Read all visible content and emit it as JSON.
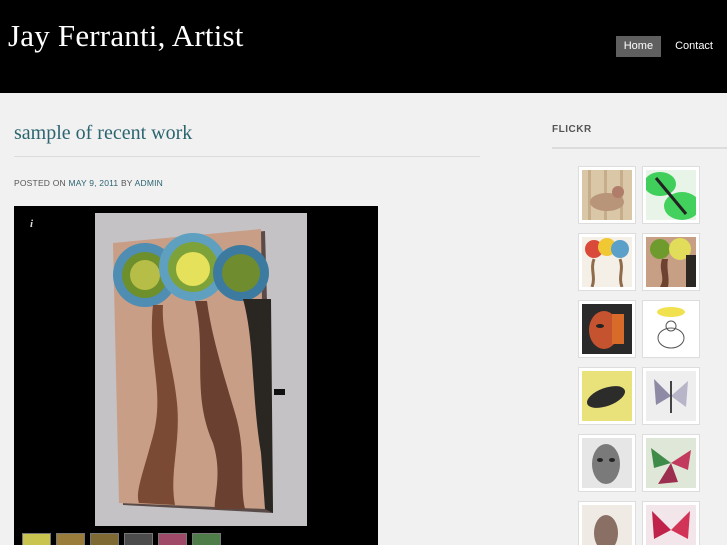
{
  "header": {
    "site_title": "Jay Ferranti, Artist",
    "nav": [
      {
        "label": "Home",
        "active": true
      },
      {
        "label": "Contact",
        "active": false
      }
    ]
  },
  "post": {
    "title": "sample of recent work",
    "meta": {
      "posted_on": "POSTED ON",
      "date": "MAY 9, 2011",
      "by": "BY",
      "author": "ADMIN"
    },
    "gallery": {
      "info_icon": "i",
      "main_image": "painting-of-three-trees-canvas",
      "thumbnails": [
        "thumb-1",
        "thumb-2",
        "thumb-3",
        "thumb-4",
        "thumb-5",
        "thumb-6"
      ]
    }
  },
  "sidebar": {
    "widget_title": "FLICKR",
    "photos": [
      "bird-drawing",
      "green-leaf-branch",
      "tree-lollipops",
      "tree-painting",
      "face-collage",
      "sketch-figure",
      "black-fish-yellow",
      "butterfly-wings",
      "face-mask",
      "red-green-flower",
      "face-profile",
      "red-butterfly"
    ]
  },
  "colors": {
    "header_bg": "#000000",
    "page_bg": "#f1f1f1",
    "accent_link": "#2c6470",
    "nav_active": "#5f5f5f"
  }
}
